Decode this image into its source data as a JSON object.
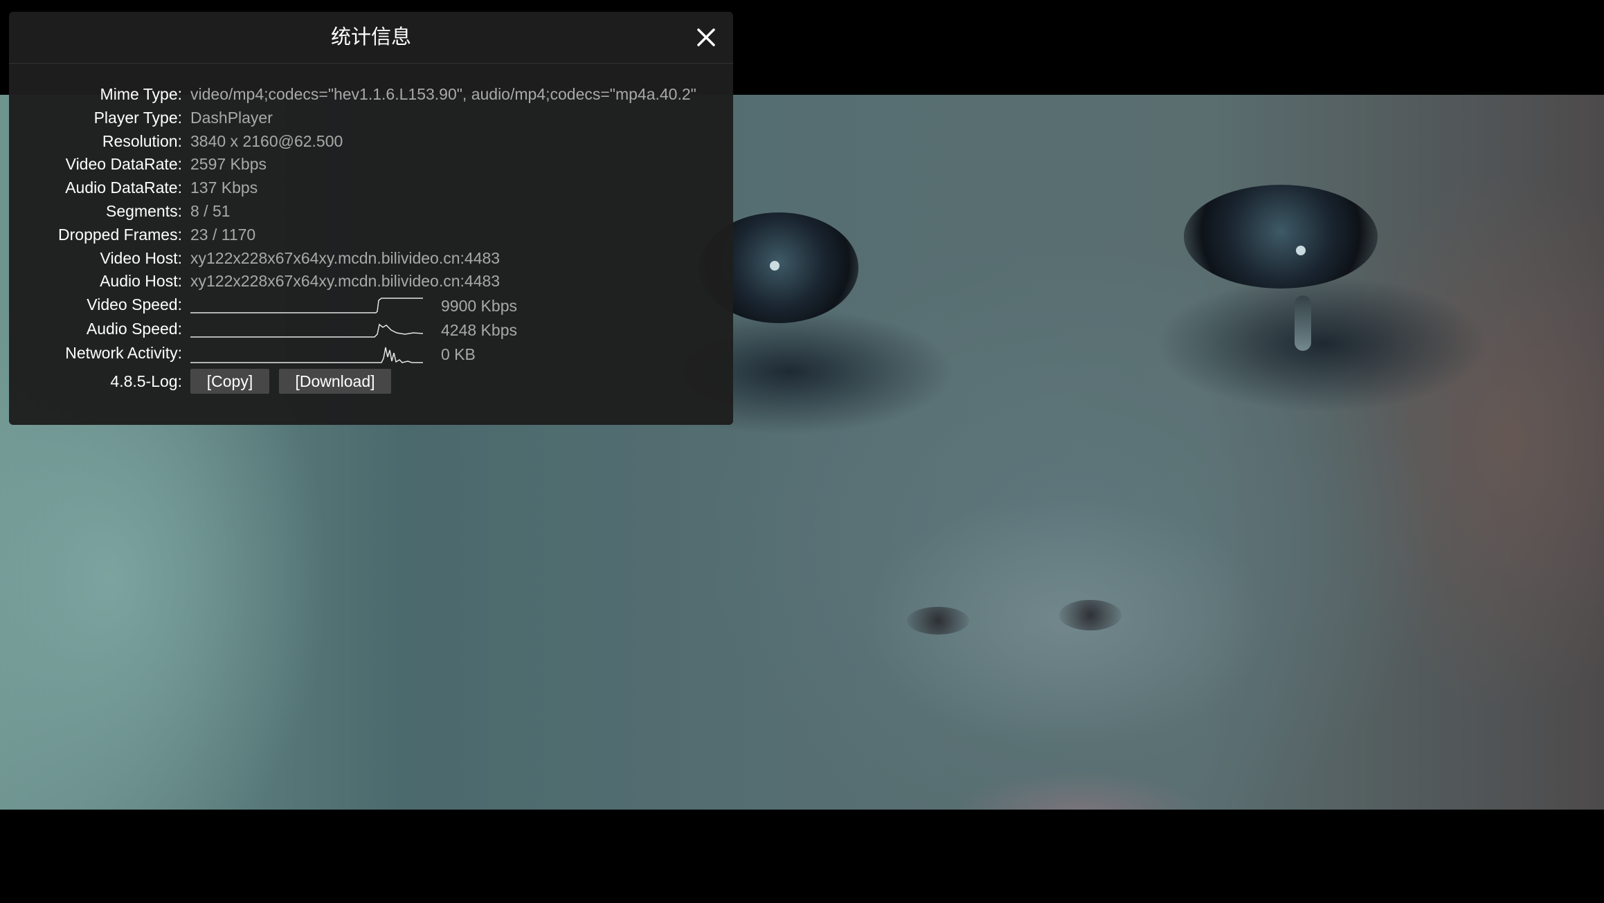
{
  "panel": {
    "title": "统计信息"
  },
  "stats": [
    {
      "label": "Mime Type:",
      "value": "video/mp4;codecs=\"hev1.1.6.L153.90\", audio/mp4;codecs=\"mp4a.40.2\""
    },
    {
      "label": "Player Type:",
      "value": "DashPlayer"
    },
    {
      "label": "Resolution:",
      "value": "3840 x 2160@62.500"
    },
    {
      "label": "Video DataRate:",
      "value": "2597 Kbps"
    },
    {
      "label": "Audio DataRate:",
      "value": "137 Kbps"
    },
    {
      "label": "Segments:",
      "value": "8 / 51"
    },
    {
      "label": "Dropped Frames:",
      "value": "23 / 1170"
    },
    {
      "label": "Video Host:",
      "value": "xy122x228x67x64xy.mcdn.bilivideo.cn:4483"
    },
    {
      "label": "Audio Host:",
      "value": "xy122x228x67x64xy.mcdn.bilivideo.cn:4483"
    }
  ],
  "graphs": [
    {
      "label": "Video Speed:",
      "value": "9900 Kbps"
    },
    {
      "label": "Audio Speed:",
      "value": "4248 Kbps"
    },
    {
      "label": "Network Activity:",
      "value": "0 KB"
    }
  ],
  "log": {
    "label": "4.8.5-Log:",
    "copy_label": "[Copy]",
    "download_label": "[Download]"
  },
  "icons": {
    "close": "close-icon"
  },
  "colors": {
    "panel_bg": "#1e1e1e",
    "label": "#ffffff",
    "value": "#a9a9a9",
    "button_bg": "#474747"
  }
}
